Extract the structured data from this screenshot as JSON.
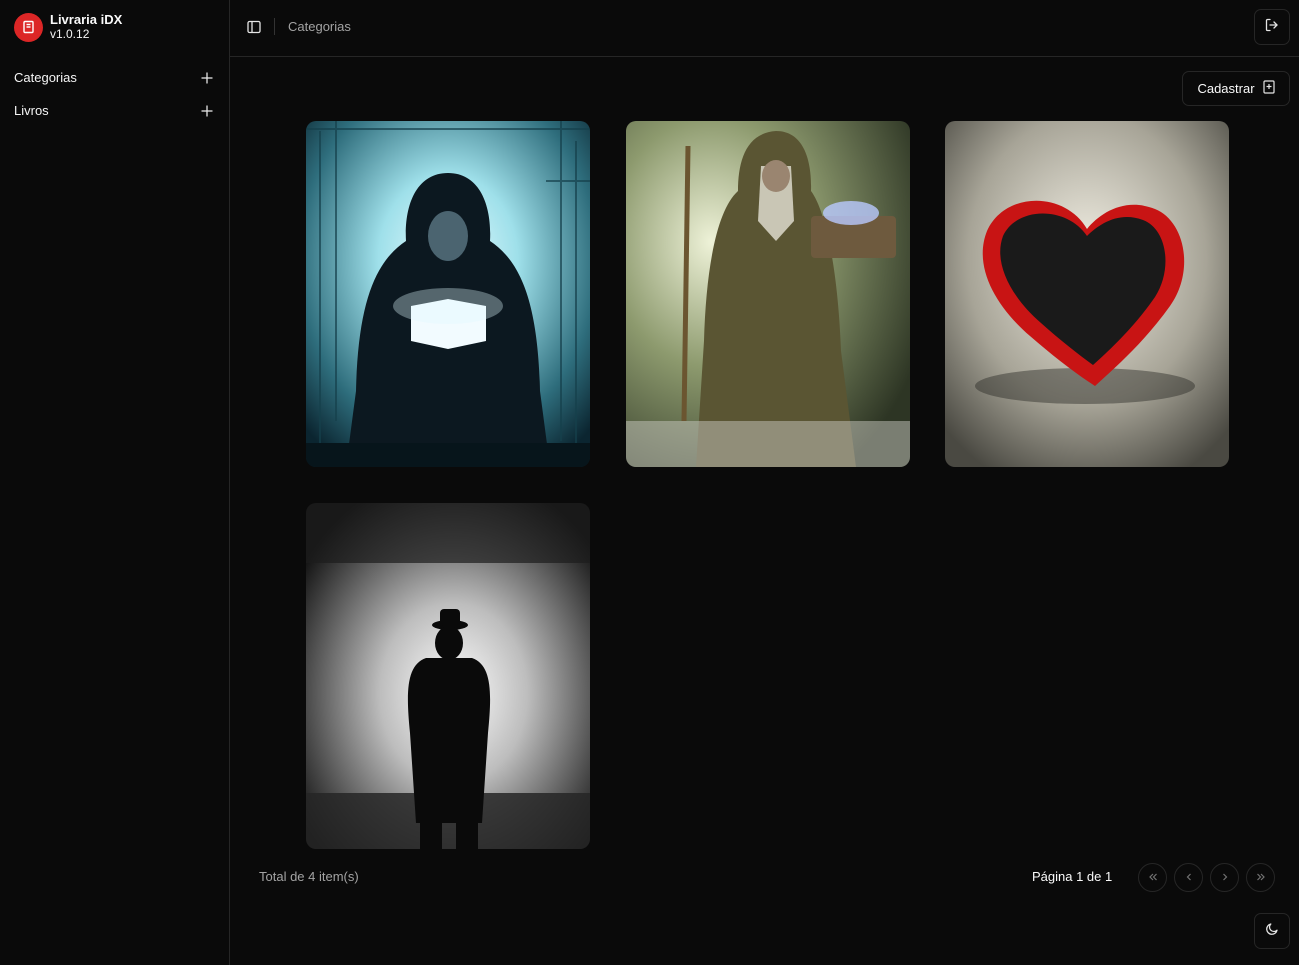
{
  "app": {
    "name": "Livraria iDX",
    "version": "v1.0.12",
    "brand_color": "#dc2626"
  },
  "sidebar": {
    "items": [
      {
        "label": "Categorias",
        "action_icon": "plus-icon"
      },
      {
        "label": "Livros",
        "action_icon": "plus-icon"
      }
    ]
  },
  "header": {
    "breadcrumb": "Categorias",
    "toggle_icon": "sidebar-toggle-icon",
    "logout_icon": "logout-icon"
  },
  "main": {
    "register_button": {
      "label": "Cadastrar",
      "icon": "book-plus-icon"
    },
    "cards": [
      {
        "image": "hooded-figure-reading-glowing-book-cyber"
      },
      {
        "image": "wizard-with-staff-and-magic-book"
      },
      {
        "image": "red-heart-shaped-box"
      },
      {
        "image": "silhouette-man-in-hat-in-fog"
      }
    ]
  },
  "footer": {
    "total": "Total de 4 item(s)",
    "page_info": "Página 1 de 1",
    "pagination_icons": [
      "chevrons-left-icon",
      "chevron-left-icon",
      "chevron-right-icon",
      "chevrons-right-icon"
    ],
    "theme_icon": "moon-icon"
  }
}
